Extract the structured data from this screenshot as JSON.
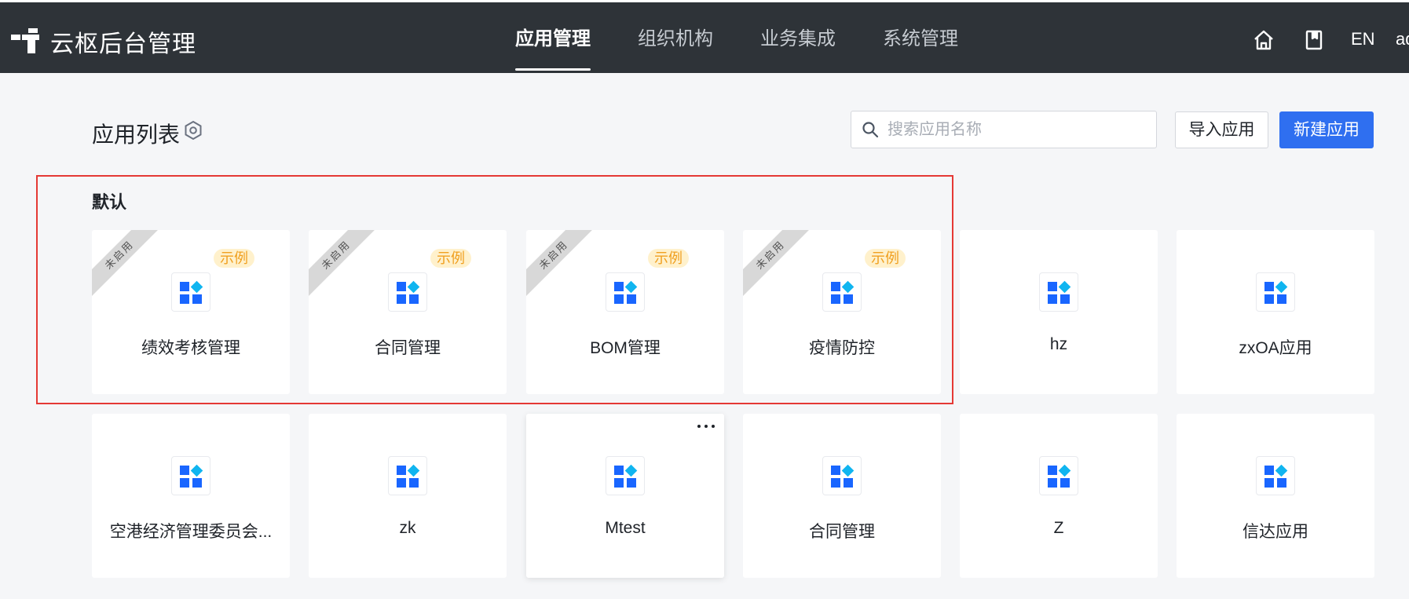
{
  "header": {
    "brand": "云枢后台管理",
    "nav": [
      {
        "label": "应用管理",
        "active": true
      },
      {
        "label": "组织机构",
        "active": false
      },
      {
        "label": "业务集成",
        "active": false
      },
      {
        "label": "系统管理",
        "active": false
      }
    ],
    "lang_label": "EN",
    "user_label": "admin",
    "icons": {
      "home": "home-icon",
      "docs": "book-icon",
      "logo": "logo-mark"
    }
  },
  "page": {
    "title": "应用列表",
    "settings_icon": "hexagon-gear-icon",
    "search": {
      "placeholder": "搜索应用名称",
      "value": ""
    },
    "import_button": "导入应用",
    "new_button": "新建应用"
  },
  "group": {
    "label": "默认"
  },
  "cards_row1": [
    {
      "name": "绩效考核管理",
      "ribbon": "未启用",
      "tag": "示例"
    },
    {
      "name": "合同管理",
      "ribbon": "未启用",
      "tag": "示例"
    },
    {
      "name": "BOM管理",
      "ribbon": "未启用",
      "tag": "示例"
    },
    {
      "name": "疫情防控",
      "ribbon": "未启用",
      "tag": "示例"
    },
    {
      "name": "hz"
    },
    {
      "name": "zxOA应用"
    }
  ],
  "cards_row2": [
    {
      "name": "空港经济管理委员会..."
    },
    {
      "name": "zk"
    },
    {
      "name": "Mtest",
      "more": true
    },
    {
      "name": "合同管理"
    },
    {
      "name": "Z"
    },
    {
      "name": "信达应用"
    }
  ],
  "colors": {
    "header_bg": "#2e3338",
    "primary": "#2f6ff0",
    "app_icon_blue": "#1966ff",
    "app_icon_cyan": "#10b5f0",
    "tag_bg": "#fff1cc",
    "tag_text": "#f0a020",
    "highlight_border": "#e53935"
  }
}
